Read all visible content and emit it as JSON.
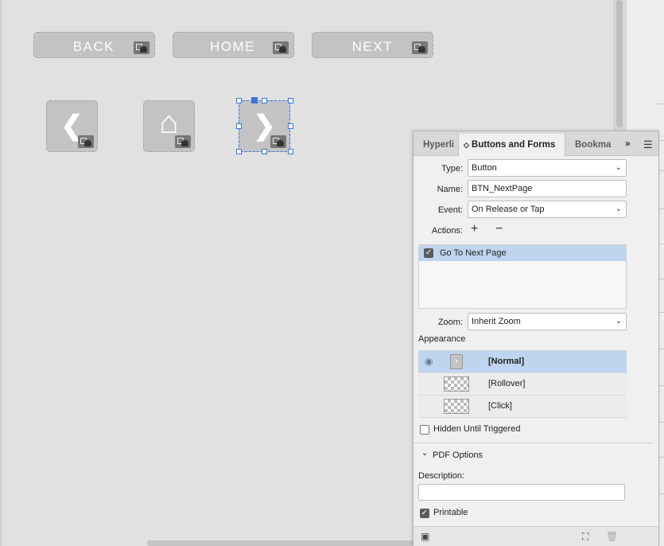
{
  "canvas": {
    "text_buttons": [
      {
        "label": "BACK"
      },
      {
        "label": "HOME"
      },
      {
        "label": "NEXT"
      }
    ],
    "icon_buttons": [
      {
        "icon": "chevron-left-icon",
        "glyph": "❮"
      },
      {
        "icon": "home-icon",
        "glyph": "⌂"
      },
      {
        "icon": "chevron-right-icon",
        "glyph": "❯"
      }
    ]
  },
  "panel": {
    "tabs": [
      {
        "label": "Hyperli"
      },
      {
        "label": "Buttons and Forms",
        "prefix": "◇"
      },
      {
        "label": "Bookma"
      }
    ],
    "more_label": "»",
    "menu_icon": "☰",
    "type": {
      "label": "Type:",
      "value": "Button"
    },
    "name": {
      "label": "Name:",
      "value": "BTN_NextPage"
    },
    "event": {
      "label": "Event:",
      "value": "On Release or Tap"
    },
    "actions": {
      "label": "Actions:",
      "add": "+",
      "remove": "−",
      "items": [
        {
          "label": "Go To Next Page",
          "checked": true
        }
      ]
    },
    "zoom": {
      "label": "Zoom:",
      "value": "Inherit Zoom"
    },
    "appearance": {
      "label": "Appearance",
      "states": [
        {
          "name": "[Normal]",
          "selected": true
        },
        {
          "name": "[Rollover]",
          "selected": false
        },
        {
          "name": "[Click]",
          "selected": false
        }
      ]
    },
    "hidden_until_triggered": {
      "label": "Hidden Until Triggered",
      "checked": false
    },
    "pdf_options": {
      "label": "PDF Options",
      "toggle": "⌄"
    },
    "description": {
      "label": "Description:",
      "value": ""
    },
    "printable": {
      "label": "Printable",
      "checked": true
    },
    "colors": {
      "selection": "#bfd5ef",
      "accent": "#3b74e0"
    }
  }
}
